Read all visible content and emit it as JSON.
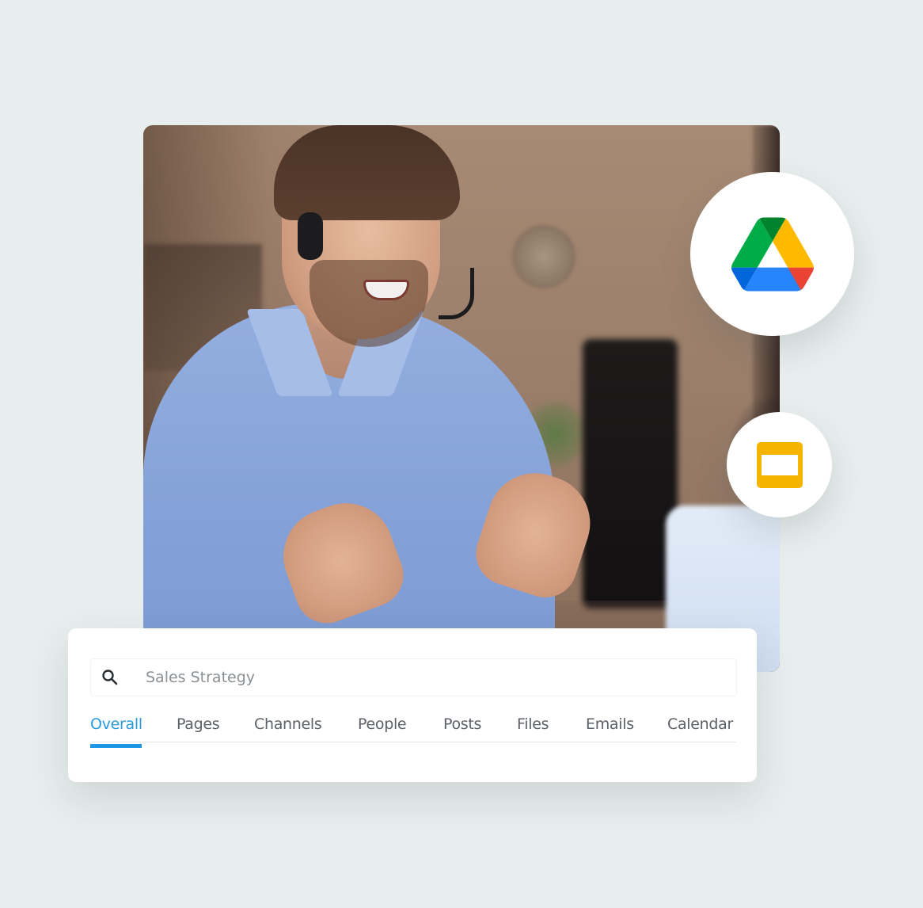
{
  "photo": {
    "description": "Man wearing headset in blue shirt gesturing while talking"
  },
  "integrations": [
    {
      "name": "Google Drive",
      "icon": "google-drive-icon",
      "colors": [
        "#0F9D58",
        "#FFBA00",
        "#2684FC",
        "#EA4335",
        "#0066DA",
        "#00832D"
      ]
    },
    {
      "name": "Google Slides",
      "icon": "google-slides-icon",
      "colors": [
        "#F4B400",
        "#FFFFFF"
      ]
    }
  ],
  "search": {
    "value": "Sales Strategy",
    "placeholder": "Sales Strategy"
  },
  "tabs": [
    {
      "label": "Overall",
      "active": true
    },
    {
      "label": "Pages",
      "active": false
    },
    {
      "label": "Channels",
      "active": false
    },
    {
      "label": "People",
      "active": false
    },
    {
      "label": "Posts",
      "active": false
    },
    {
      "label": "Files",
      "active": false
    },
    {
      "label": "Emails",
      "active": false
    },
    {
      "label": "Calendar",
      "active": false
    }
  ],
  "colors": {
    "accent": "#1E96E4",
    "background": "#E8EDED",
    "tab_text": "#5B6166",
    "search_text": "#8B9094"
  }
}
